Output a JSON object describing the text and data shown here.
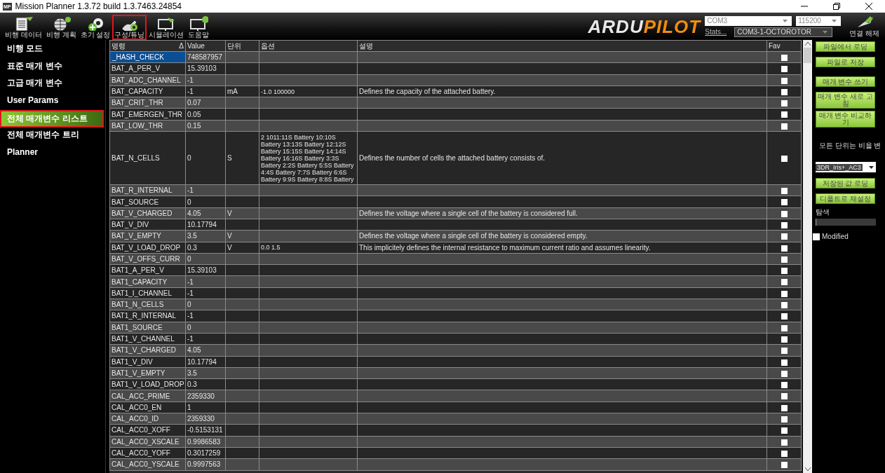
{
  "window": {
    "title": "Mission Planner 1.3.72 build 1.3.7463.24854",
    "app_badge": "MP"
  },
  "toolbar": {
    "items": [
      {
        "label": "비행 데이터",
        "selected": false
      },
      {
        "label": "비행 계획",
        "selected": false
      },
      {
        "label": "초기 설정",
        "selected": false
      },
      {
        "label": "구성/튜닝",
        "selected": true
      },
      {
        "label": "시뮬레이션",
        "selected": false
      },
      {
        "label": "도움말",
        "selected": false
      }
    ],
    "logo": {
      "part_1": "ARDU",
      "part_2": "PILOT"
    },
    "port": "COM3",
    "baud": "115200",
    "stats_link": "Stats...",
    "vehicle": "COM3-1-OCTOROTOR",
    "connect_label": "연결 해제"
  },
  "sidebar": {
    "items": [
      {
        "label": "비행 모드",
        "selected": false
      },
      {
        "label": "표준 매개 변수",
        "selected": false
      },
      {
        "label": "고급 매개 변수",
        "selected": false
      },
      {
        "label": "User Params",
        "selected": false
      },
      {
        "label": "전체 매개변수 리스트",
        "selected": true
      },
      {
        "label": "전체 매개변수 트리",
        "selected": false
      },
      {
        "label": "Planner",
        "selected": false
      }
    ]
  },
  "table": {
    "columns": [
      "명령",
      "Value",
      "단위",
      "옵션",
      "설명",
      "Fav"
    ],
    "sort_mark": "Δ",
    "rows": [
      {
        "name": "_HASH_CHECK",
        "value": "748587957",
        "selected": true,
        "fav": false
      },
      {
        "name": "BAT_A_PER_V",
        "value": "15.39103",
        "selected": false,
        "fav": false
      },
      {
        "name": "BAT_ADC_CHANNEL",
        "value": "-1",
        "selected": false,
        "fav": false
      },
      {
        "name": "BAT_CAPACITY",
        "value": "-1",
        "unit": "mA",
        "options": "-1.0 100000",
        "description": "Defines the capacity of the attached battery.",
        "selected": false,
        "fav": false
      },
      {
        "name": "BAT_CRIT_THR",
        "value": "0.07",
        "selected": false,
        "fav": false
      },
      {
        "name": "BAT_EMERGEN_THR",
        "value": "0.05",
        "selected": false,
        "fav": false
      },
      {
        "name": "BAT_LOW_THR",
        "value": "0.15",
        "selected": false,
        "fav": false
      },
      {
        "name": "BAT_N_CELLS",
        "value": "0",
        "unit": "S",
        "options": "2 1011:11S Battery 10:10S Battery 13:13S Battery 12:12S Battery 15:15S Battery 14:14S Battery 16:16S Battery 3:3S Battery 2:2S Battery 5:5S Battery 4:4S Battery 7:7S Battery 6:6S Battery 9:9S Battery 8:8S Battery",
        "description": "Defines the number of cells the attached battery consists of.",
        "selected": false,
        "fav": false
      },
      {
        "name": "BAT_R_INTERNAL",
        "value": "-1",
        "selected": false,
        "fav": false
      },
      {
        "name": "BAT_SOURCE",
        "value": "0",
        "selected": false,
        "fav": false
      },
      {
        "name": "BAT_V_CHARGED",
        "value": "4.05",
        "unit": "V",
        "description": "Defines the voltage where a single cell of the battery is considered full.",
        "selected": false,
        "fav": false
      },
      {
        "name": "BAT_V_DIV",
        "value": "10.17794",
        "selected": false,
        "fav": false
      },
      {
        "name": "BAT_V_EMPTY",
        "value": "3.5",
        "unit": "V",
        "description": "Defines the voltage where a single cell of the battery is considered empty.",
        "selected": false,
        "fav": false
      },
      {
        "name": "BAT_V_LOAD_DROP",
        "value": "0.3",
        "unit": "V",
        "options": "0.0 1.5",
        "description": "This implicitely defines the internal resistance to maximum current ratio and assumes linearity.",
        "selected": false,
        "fav": false
      },
      {
        "name": "BAT_V_OFFS_CURR",
        "value": "0",
        "selected": false,
        "fav": false
      },
      {
        "name": "BAT1_A_PER_V",
        "value": "15.39103",
        "selected": false,
        "fav": false
      },
      {
        "name": "BAT1_CAPACITY",
        "value": "-1",
        "selected": false,
        "fav": false
      },
      {
        "name": "BAT1_I_CHANNEL",
        "value": "-1",
        "selected": false,
        "fav": false
      },
      {
        "name": "BAT1_N_CELLS",
        "value": "0",
        "selected": false,
        "fav": false
      },
      {
        "name": "BAT1_R_INTERNAL",
        "value": "-1",
        "selected": false,
        "fav": false
      },
      {
        "name": "BAT1_SOURCE",
        "value": "0",
        "selected": false,
        "fav": false
      },
      {
        "name": "BAT1_V_CHANNEL",
        "value": "-1",
        "selected": false,
        "fav": false
      },
      {
        "name": "BAT1_V_CHARGED",
        "value": "4.05",
        "selected": false,
        "fav": false
      },
      {
        "name": "BAT1_V_DIV",
        "value": "10.17794",
        "selected": false,
        "fav": false
      },
      {
        "name": "BAT1_V_EMPTY",
        "value": "3.5",
        "selected": false,
        "fav": false
      },
      {
        "name": "BAT1_V_LOAD_DROP",
        "value": "0.3",
        "selected": false,
        "fav": false
      },
      {
        "name": "CAL_ACC_PRIME",
        "value": "2359330",
        "selected": false,
        "fav": false
      },
      {
        "name": "CAL_ACC0_EN",
        "value": "1",
        "selected": false,
        "fav": false
      },
      {
        "name": "CAL_ACC0_ID",
        "value": "2359330",
        "selected": false,
        "fav": false
      },
      {
        "name": "CAL_ACC0_XOFF",
        "value": "-0.5153131",
        "selected": false,
        "fav": false
      },
      {
        "name": "CAL_ACC0_XSCALE",
        "value": "0.9986583",
        "selected": false,
        "fav": false
      },
      {
        "name": "CAL_ACC0_YOFF",
        "value": "0.3017259",
        "selected": false,
        "fav": false
      },
      {
        "name": "CAL_ACC0_YSCALE",
        "value": "0.9997563",
        "selected": false,
        "fav": false
      }
    ]
  },
  "panel": {
    "buttons_top": [
      "파일에서 로딩",
      "파일로 저장"
    ],
    "buttons_mid": [
      "매개 변수 쓰기",
      "매개 변수 새로 고침",
      "매개 변수 비교하기"
    ],
    "units_note": "모든 단위는 비율 변",
    "preset": "3DR_Iris+_AC3",
    "buttons_bottom": [
      "저장된 값 로딩",
      "디폴트로 재설정"
    ],
    "search_label": "탐색",
    "modified": {
      "label": "Modified",
      "checked": false
    }
  }
}
